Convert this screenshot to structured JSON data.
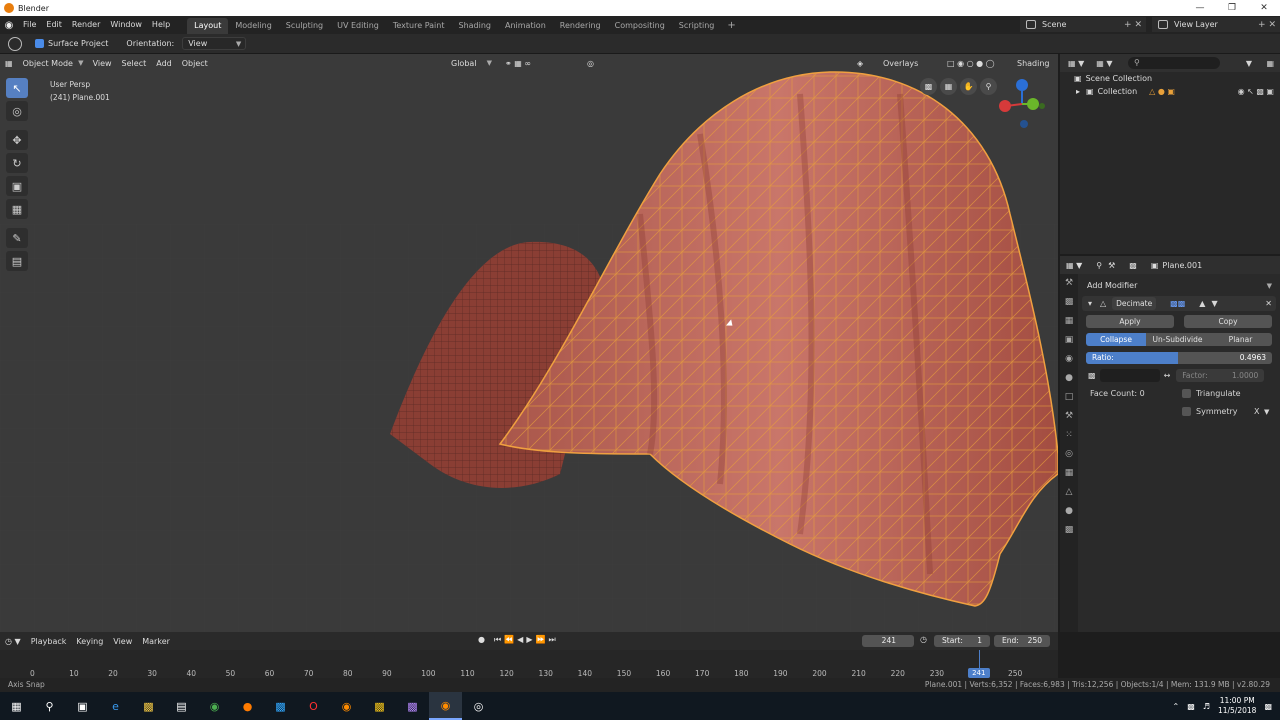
{
  "window": {
    "title": "Blender"
  },
  "menu": [
    "File",
    "Edit",
    "Render",
    "Window",
    "Help"
  ],
  "workspaces": [
    {
      "label": "Layout",
      "active": true
    },
    {
      "label": "Modeling"
    },
    {
      "label": "Sculpting"
    },
    {
      "label": "UV Editing"
    },
    {
      "label": "Texture Paint"
    },
    {
      "label": "Shading"
    },
    {
      "label": "Animation"
    },
    {
      "label": "Rendering"
    },
    {
      "label": "Compositing"
    },
    {
      "label": "Scripting"
    }
  ],
  "scene": "Scene",
  "view_layer": "View Layer",
  "tool_settings": {
    "surface_project": "Surface Project",
    "orientation_label": "Orientation:",
    "orientation_value": "View"
  },
  "viewport": {
    "mode": "Object Mode",
    "menus": [
      "View",
      "Select",
      "Add",
      "Object"
    ],
    "transform": "Global",
    "overlays": "Overlays",
    "shading": "Shading",
    "persp": "User Persp",
    "object_info": "(241) Plane.001"
  },
  "outliner": {
    "root": "Scene Collection",
    "collection": "Collection"
  },
  "properties": {
    "object_name": "Plane.001",
    "add_modifier": "Add Modifier",
    "modifier_name": "Decimate",
    "apply": "Apply",
    "copy": "Copy",
    "modes": [
      "Collapse",
      "Un-Subdivide",
      "Planar"
    ],
    "ratio_label": "Ratio:",
    "ratio_value": "0.4963",
    "ratio": 0.4963,
    "factor_label": "Factor:",
    "factor_value": "1.0000",
    "face_count": "Face Count: 0",
    "triangulate": "Triangulate",
    "symmetry": "Symmetry",
    "symmetry_axis": "X"
  },
  "timeline": {
    "menus": [
      "Playback",
      "Keying",
      "View",
      "Marker"
    ],
    "current_frame": "241",
    "start_label": "Start:",
    "start_value": "1",
    "end_label": "End:",
    "end_value": "250",
    "ticks": [
      "0",
      "10",
      "20",
      "30",
      "40",
      "50",
      "60",
      "70",
      "80",
      "90",
      "100",
      "110",
      "120",
      "130",
      "140",
      "150",
      "160",
      "170",
      "180",
      "190",
      "200",
      "210",
      "220",
      "230",
      "240",
      "250"
    ],
    "playhead_label": "241"
  },
  "status": {
    "left": "Axis Snap",
    "right": "Plane.001 | Verts:6,352 | Faces:6,983 | Tris:12,256 | Objects:1/4 | Mem: 131.9 MB | v2.80.29"
  },
  "clock": {
    "time": "11:00 PM",
    "date": "11/5/2018"
  }
}
